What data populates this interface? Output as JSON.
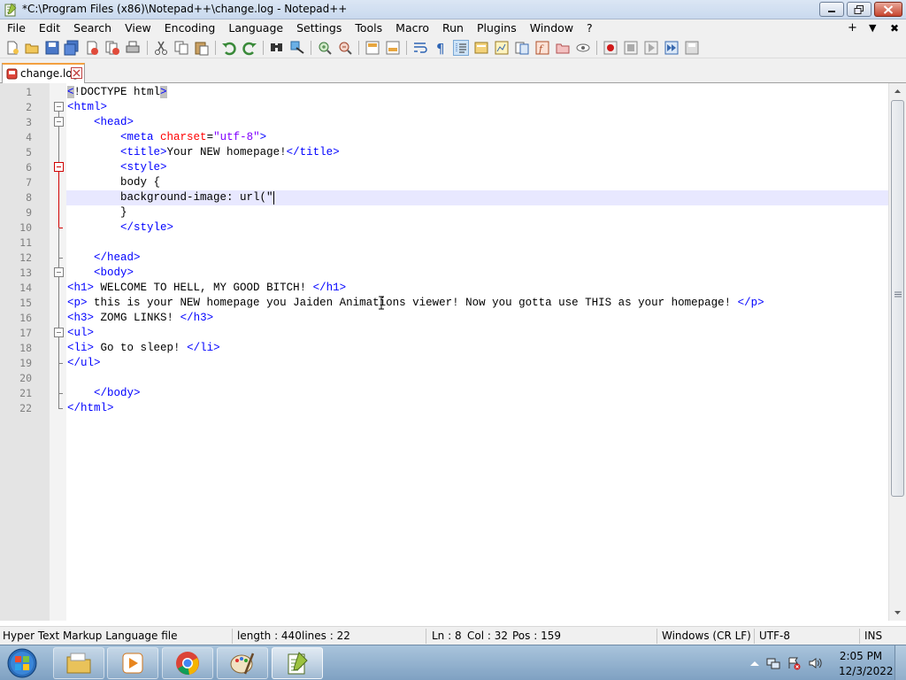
{
  "window": {
    "title": "*C:\\Program Files (x86)\\Notepad++\\change.log - Notepad++",
    "icons": {
      "app": "notepad-plus-plus-icon",
      "minimize": "minimize-icon",
      "maximize": "restore-icon",
      "close": "close-icon"
    }
  },
  "menu": {
    "items": [
      "File",
      "Edit",
      "Search",
      "View",
      "Encoding",
      "Language",
      "Settings",
      "Tools",
      "Macro",
      "Run",
      "Plugins",
      "Window",
      "?"
    ],
    "right": {
      "plus": "+",
      "dropdown": "▼",
      "close": "✖"
    }
  },
  "toolbar": {
    "icons": [
      "new-file-icon",
      "open-file-icon",
      "save-icon",
      "save-all-icon",
      "close-icon",
      "close-all-icon",
      "print-icon",
      "cut-icon",
      "copy-icon",
      "paste-icon",
      "undo-icon",
      "redo-icon",
      "find-icon",
      "replace-icon",
      "zoom-in-icon",
      "zoom-out-icon",
      "sync-vertical-icon",
      "sync-horizontal-icon",
      "word-wrap-icon",
      "show-all-chars-icon",
      "indent-guide-icon",
      "language-icon",
      "folder-as-workspace-icon",
      "document-map-icon",
      "function-list-icon",
      "monitoring-icon",
      "record-macro-icon",
      "stop-macro-icon",
      "play-macro-icon",
      "run-macro-multiple-icon",
      "save-macro-icon"
    ]
  },
  "tabs": [
    {
      "label": "change.log",
      "icon": "unsaved-file-icon",
      "close_icon": "tab-close-icon",
      "active": true
    }
  ],
  "editor": {
    "lines": [
      {
        "n": "1",
        "text": "<!DOCTYPE html>"
      },
      {
        "n": "2",
        "text": "<html>"
      },
      {
        "n": "3",
        "text": "    <head>"
      },
      {
        "n": "4",
        "text": "        <meta charset=\"utf-8\">"
      },
      {
        "n": "5",
        "text": "        <title>Your NEW homepage!</title>"
      },
      {
        "n": "6",
        "text": "        <style>"
      },
      {
        "n": "7",
        "text": "        body {"
      },
      {
        "n": "8",
        "text": "        background-image: url(\""
      },
      {
        "n": "9",
        "text": "        }"
      },
      {
        "n": "10",
        "text": "        </style>"
      },
      {
        "n": "11",
        "text": ""
      },
      {
        "n": "12",
        "text": "    </head>"
      },
      {
        "n": "13",
        "text": "    <body>"
      },
      {
        "n": "14",
        "text": "<h1> WELCOME TO HELL, MY GOOD BITCH! </h1>"
      },
      {
        "n": "15",
        "text": "<p> this is your NEW homepage you Jaiden Animations viewer! Now you gotta use THIS as your homepage! </p>"
      },
      {
        "n": "16",
        "text": "<h3> ZOMG LINKS! </h3>"
      },
      {
        "n": "17",
        "text": "<ul>"
      },
      {
        "n": "18",
        "text": "<li> Go to sleep! </li>"
      },
      {
        "n": "19",
        "text": "</ul>"
      },
      {
        "n": "20",
        "text": ""
      },
      {
        "n": "21",
        "text": "    </body>"
      },
      {
        "n": "22",
        "text": "</html>"
      }
    ],
    "current_line": 8
  },
  "status": {
    "file_type": "Hyper Text Markup Language file",
    "length": "length : 440",
    "lines": "lines : 22",
    "ln": "Ln : 8",
    "col": "Col : 32",
    "pos": "Pos : 159",
    "eol": "Windows (CR LF)",
    "encoding": "UTF-8",
    "mode": "INS"
  },
  "taskbar": {
    "start_icon": "windows-start-icon",
    "apps": [
      "file-explorer-icon",
      "media-player-icon",
      "chrome-icon",
      "paint-icon",
      "notepad-plus-plus-icon"
    ],
    "tray_icons": [
      "show-hidden-icons-icon",
      "network-icon",
      "action-center-icon",
      "volume-icon"
    ],
    "time": "2:05 PM",
    "date": "12/3/2022"
  },
  "colors": {
    "tag": "#0000ff",
    "attribute": "#ff0000",
    "value": "#8000ff",
    "current_line": "#e8e8ff",
    "gutter": "#e4e4e4"
  }
}
